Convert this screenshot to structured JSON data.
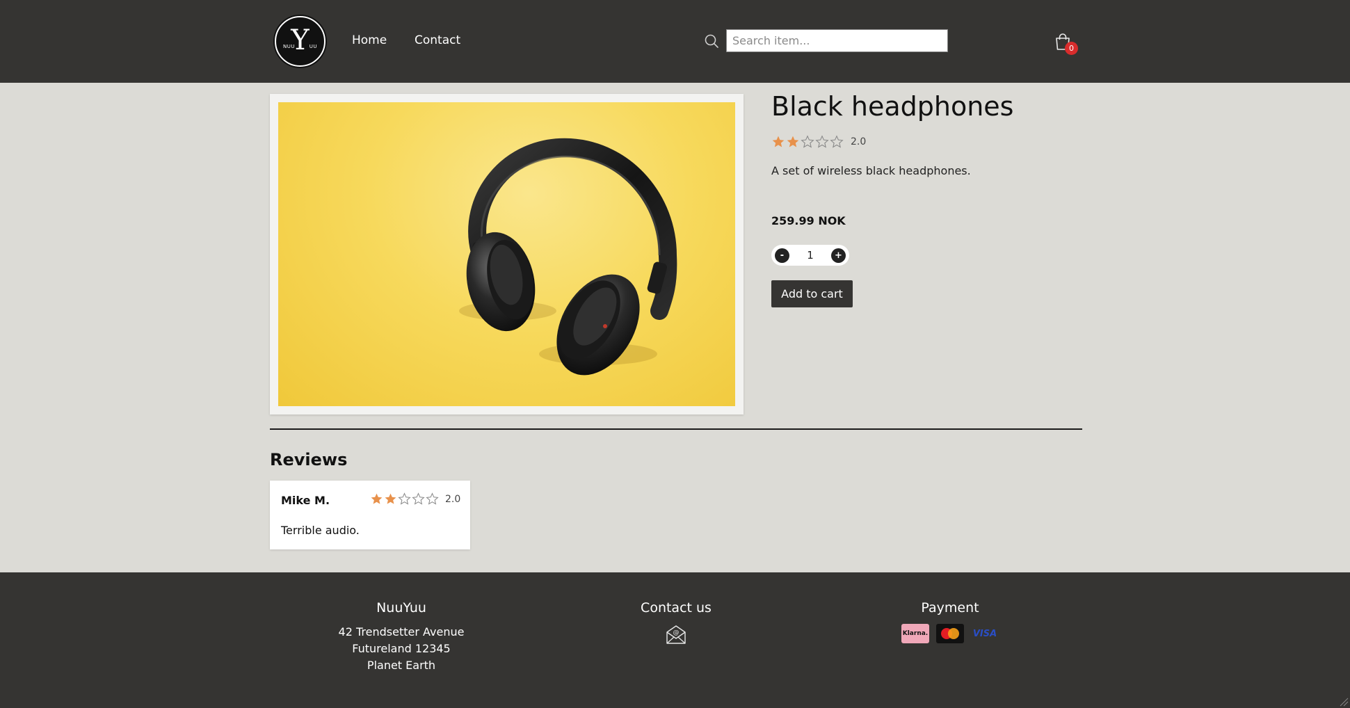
{
  "header": {
    "logo": {
      "letter": "Y",
      "left_text": "NUU",
      "right_text": "UU"
    },
    "nav": [
      {
        "label": "Home"
      },
      {
        "label": "Contact"
      }
    ],
    "search": {
      "placeholder": "Search item...",
      "icon": "search-icon"
    },
    "cart": {
      "icon": "shopping-bag-icon",
      "count": "0",
      "badge_color": "#d92c2c"
    }
  },
  "product": {
    "title": "Black headphones",
    "rating": {
      "value": "2.0",
      "stars": 2,
      "max": 5,
      "star_color": "#e8914b"
    },
    "description": "A set of wireless black headphones.",
    "price": "259.99 NOK",
    "quantity": {
      "minus": "-",
      "value": "1",
      "plus": "+"
    },
    "add_to_cart": "Add to cart",
    "image": {
      "subject": "black over-ear headphones on yellow background",
      "background": "#f5d54e"
    }
  },
  "reviews": {
    "title": "Reviews",
    "items": [
      {
        "name": "Mike M.",
        "rating": "2.0",
        "stars": 2,
        "text": "Terrible audio."
      }
    ]
  },
  "footer": {
    "company": {
      "title": "NuuYuu",
      "address": [
        "42 Trendsetter Avenue",
        "Futureland 12345",
        "Planet Earth"
      ]
    },
    "contact": {
      "title": "Contact us",
      "icon": "email-icon"
    },
    "payment": {
      "title": "Payment",
      "methods": [
        "Klarna.",
        "MasterCard",
        "VISA"
      ]
    }
  },
  "colors": {
    "header_bg": "#353432",
    "page_bg": "#dcdbd6",
    "accent_star": "#e8914b"
  }
}
